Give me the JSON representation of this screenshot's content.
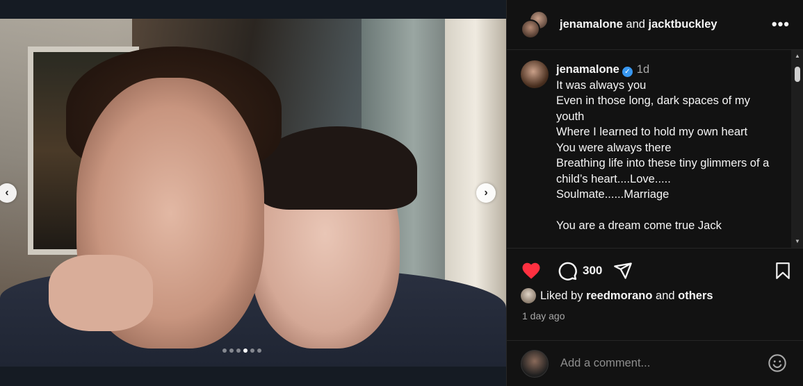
{
  "post": {
    "header": {
      "user1": "jenamalone",
      "joiner": "and",
      "user2": "jacktbuckley",
      "more_icon": "more-horizontal-icon"
    },
    "caption": {
      "username": "jenamalone",
      "verified": true,
      "time": "1d",
      "text": "It was always you\nEven in those long, dark spaces of my youth\nWhere I learned to hold my own heart\nYou were always there\nBreathing life into these tiny glimmers of a child’s heart....Love.....\nSoulmate......Marriage\n\nYou are a dream come true Jack"
    },
    "actions": {
      "liked": true,
      "comment_count": "300",
      "heart_color": "#ff3040"
    },
    "likes": {
      "prefix": "Liked by",
      "user": "reedmorano",
      "joiner": "and",
      "others": "others"
    },
    "time_ago": "1 day ago",
    "compose": {
      "placeholder": "Add a comment..."
    },
    "carousel": {
      "dot_count": 6,
      "active_index": 3
    }
  }
}
